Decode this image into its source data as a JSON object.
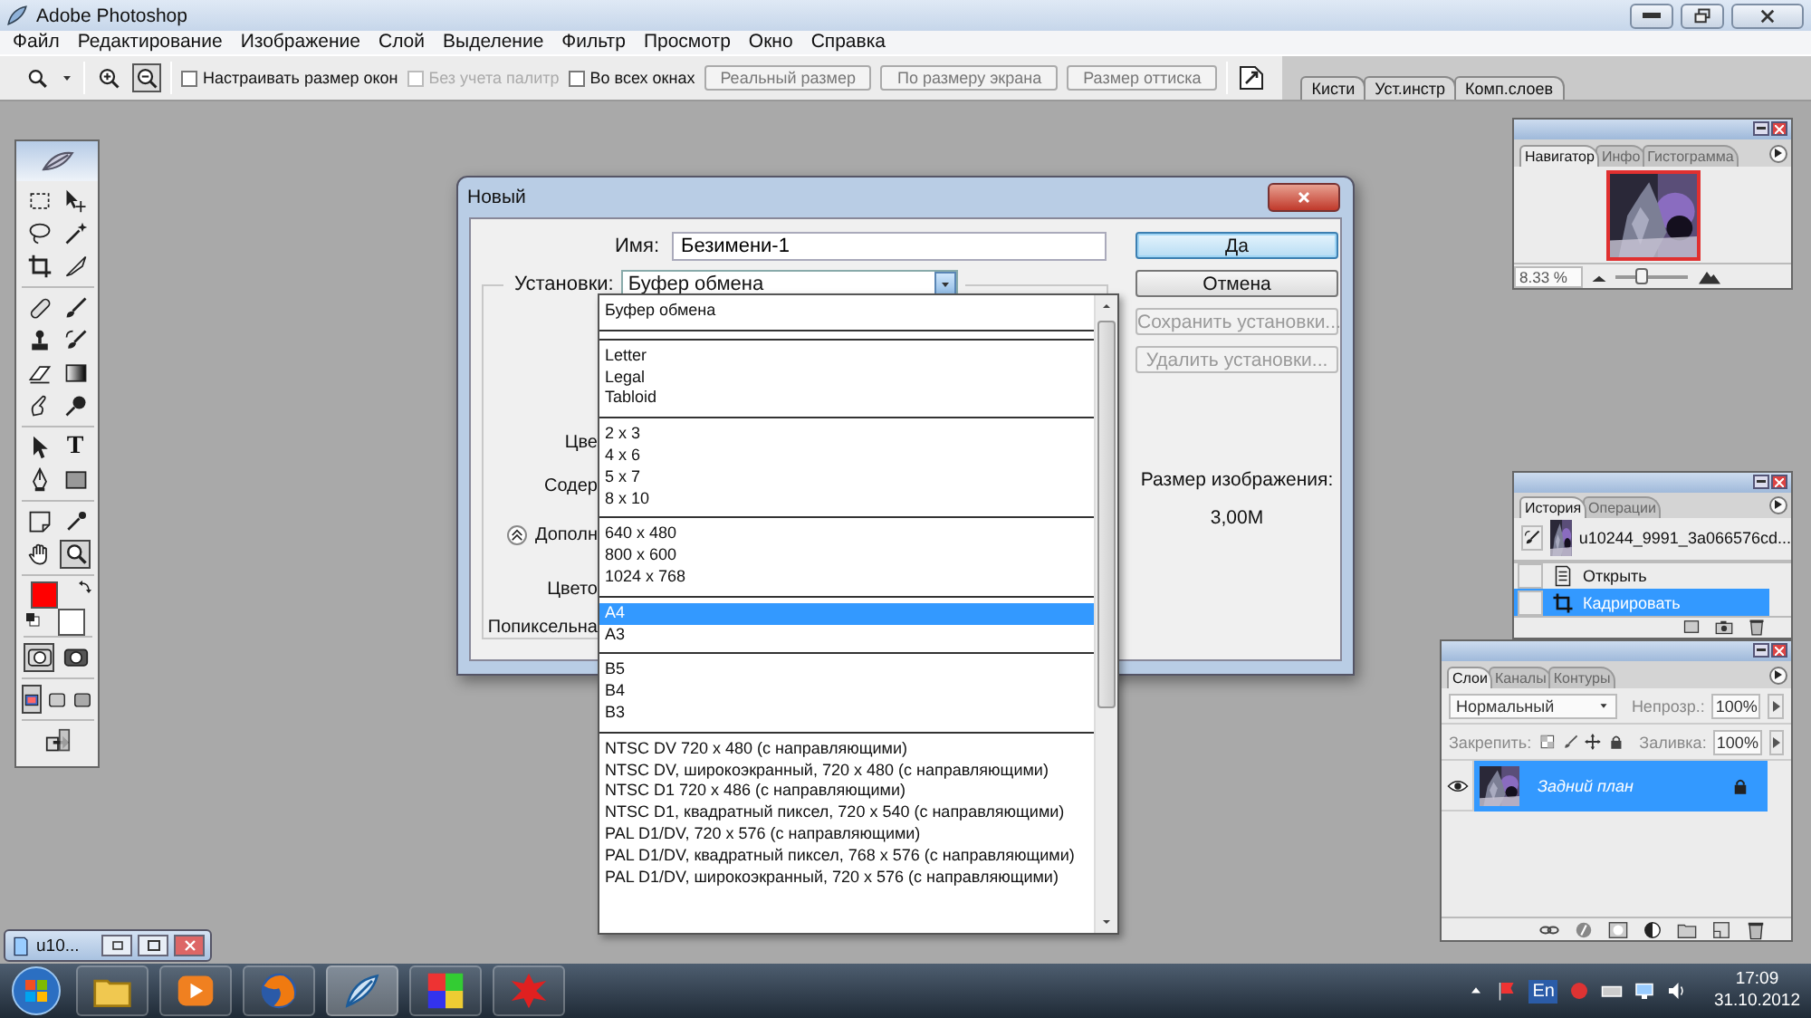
{
  "window": {
    "title": "Adobe Photoshop"
  },
  "menu": [
    "Файл",
    "Редактирование",
    "Изображение",
    "Слой",
    "Выделение",
    "Фильтр",
    "Просмотр",
    "Окно",
    "Справка"
  ],
  "options_bar": {
    "zoom_modes": [
      {
        "kind": "zoom-in",
        "selected": false
      },
      {
        "kind": "zoom-out",
        "selected": true
      }
    ],
    "checkboxes": [
      {
        "label": "Настраивать размер окон",
        "checked": false,
        "disabled": false
      },
      {
        "label": "Без учета палитр",
        "checked": false,
        "disabled": true
      },
      {
        "label": "Во всех окнах",
        "checked": false,
        "disabled": false
      }
    ],
    "buttons": [
      "Реальный размер",
      "По размеру экрана",
      "Размер оттиска"
    ],
    "palette_tabs": [
      {
        "label": "Кисти",
        "selected": false
      },
      {
        "label": "Уст.инстр",
        "selected": false
      },
      {
        "label": "Комп.слоев",
        "selected": false
      }
    ]
  },
  "toolbox": {
    "tool_groups": [
      [
        {
          "kind": "marquee",
          "selected": false
        },
        {
          "kind": "move",
          "selected": false
        },
        {
          "kind": "lasso",
          "selected": false
        },
        {
          "kind": "wand",
          "selected": false
        },
        {
          "kind": "crop",
          "selected": false
        },
        {
          "kind": "slice",
          "selected": false
        }
      ],
      [
        {
          "kind": "healing",
          "selected": false
        },
        {
          "kind": "brush",
          "selected": false
        },
        {
          "kind": "stamp",
          "selected": false
        },
        {
          "kind": "history-brush",
          "selected": false
        },
        {
          "kind": "eraser",
          "selected": false
        },
        {
          "kind": "gradient",
          "selected": false
        },
        {
          "kind": "smudge",
          "selected": false
        },
        {
          "kind": "dodge",
          "selected": false
        }
      ],
      [
        {
          "kind": "path-select",
          "selected": false
        },
        {
          "kind": "type",
          "label": "T",
          "selected": false
        },
        {
          "kind": "pen",
          "selected": false
        },
        {
          "kind": "shape",
          "selected": false
        }
      ],
      [
        {
          "kind": "notes",
          "selected": false
        },
        {
          "kind": "eyedropper",
          "selected": false
        },
        {
          "kind": "hand",
          "selected": false
        },
        {
          "kind": "zoom",
          "selected": true
        }
      ],
      [
        {
          "kind": "standard-mode",
          "selected": true
        },
        {
          "kind": "quick-mask",
          "selected": false
        }
      ],
      [
        {
          "kind": "screen-standard",
          "selected": true
        },
        {
          "kind": "screen-menu",
          "selected": false
        },
        {
          "kind": "screen-full",
          "selected": false
        }
      ],
      [
        {
          "kind": "jump",
          "selected": false
        }
      ]
    ],
    "swatches": [
      {
        "kind": "foreground",
        "color": "#ff0000"
      },
      {
        "kind": "background",
        "color": "#ffffff"
      }
    ]
  },
  "dialog": {
    "title": "Новый",
    "name_label": "Имя:",
    "name_value": "Безимени-1",
    "preset_label": "Установки:",
    "preset_value": "Буфер обмена",
    "hidden_labels": [
      {
        "kind": "label",
        "text": "Цве"
      },
      {
        "kind": "label",
        "text": "Содер"
      },
      {
        "kind": "expander",
        "text": "Дополн"
      },
      {
        "kind": "label",
        "text": "Цвето"
      },
      {
        "kind": "label",
        "text": "Попиксельна"
      }
    ],
    "buttons": [
      {
        "label": "Да",
        "kind": "default",
        "disabled": false
      },
      {
        "label": "Отмена",
        "kind": "normal",
        "disabled": false
      },
      {
        "label": "Сохранить установки...",
        "kind": "normal",
        "disabled": true
      },
      {
        "label": "Удалить установки...",
        "kind": "normal",
        "disabled": true
      }
    ],
    "image_size_label": "Размер изображения:",
    "image_size_value": "3,00M"
  },
  "preset_list": [
    {
      "kind": "option",
      "label": "Буфер обмена",
      "selected": false
    },
    {
      "kind": "separator"
    },
    {
      "kind": "separator"
    },
    {
      "kind": "option",
      "label": "Letter",
      "selected": false
    },
    {
      "kind": "option",
      "label": "Legal",
      "selected": false
    },
    {
      "kind": "option",
      "label": "Tabloid",
      "selected": false
    },
    {
      "kind": "separator"
    },
    {
      "kind": "option",
      "label": "2 x 3",
      "selected": false
    },
    {
      "kind": "option",
      "label": "4 x 6",
      "selected": false
    },
    {
      "kind": "option",
      "label": "5 x 7",
      "selected": false
    },
    {
      "kind": "option",
      "label": "8 x 10",
      "selected": false
    },
    {
      "kind": "separator"
    },
    {
      "kind": "option",
      "label": "640 x 480",
      "selected": false
    },
    {
      "kind": "option",
      "label": "800 x 600",
      "selected": false
    },
    {
      "kind": "option",
      "label": "1024 x 768",
      "selected": false
    },
    {
      "kind": "separator"
    },
    {
      "kind": "option",
      "label": "A4",
      "selected": true
    },
    {
      "kind": "option",
      "label": "A3",
      "selected": false
    },
    {
      "kind": "separator"
    },
    {
      "kind": "option",
      "label": "B5",
      "selected": false
    },
    {
      "kind": "option",
      "label": "B4",
      "selected": false
    },
    {
      "kind": "option",
      "label": "B3",
      "selected": false
    },
    {
      "kind": "separator"
    },
    {
      "kind": "option",
      "label": "NTSC DV 720 x 480 (с направляющими)",
      "selected": false
    },
    {
      "kind": "option",
      "label": "NTSC DV, широкоэкранный, 720 x 480 (с направляющими)",
      "selected": false
    },
    {
      "kind": "option",
      "label": "NTSC D1 720 x 486 (с направляющими)",
      "selected": false
    },
    {
      "kind": "option",
      "label": "NTSC D1, квадратный пиксел, 720 x 540 (с направляющими)",
      "selected": false
    },
    {
      "kind": "option",
      "label": "PAL D1/DV, 720 x 576 (с направляющими)",
      "selected": false
    },
    {
      "kind": "option",
      "label": "PAL D1/DV, квадратный пиксел, 768 x 576 (с направляющими)",
      "selected": false
    },
    {
      "kind": "option",
      "label": "PAL D1/DV, широкоэкранный, 720 x 576 (с направляющими)",
      "selected": false
    }
  ],
  "navigator": {
    "tabs": [
      {
        "label": "Навигатор",
        "selected": true
      },
      {
        "label": "Инфо",
        "selected": false
      },
      {
        "label": "Гистограмма",
        "selected": false
      }
    ],
    "zoom": "8.33 %",
    "level": 0.35
  },
  "history": {
    "tabs": [
      {
        "label": "История",
        "selected": true
      },
      {
        "label": "Операции",
        "selected": false
      }
    ],
    "snapshot": "u10244_9991_3a066576cd...",
    "steps": [
      {
        "kind": "open",
        "label": "Открыть",
        "selected": false
      },
      {
        "kind": "crop",
        "label": "Кадрировать",
        "selected": true
      }
    ]
  },
  "layers": {
    "tabs": [
      {
        "label": "Слои",
        "selected": true
      },
      {
        "label": "Каналы",
        "selected": false
      },
      {
        "label": "Контуры",
        "selected": false
      }
    ],
    "blend_mode": "Нормальный",
    "opacity_label": "Непрозр.:",
    "opacity": "100%",
    "lock_label": "Закрепить:",
    "fill_label": "Заливка:",
    "fill": "100%",
    "items": [
      {
        "name": "Задний план",
        "visible": true,
        "selected": true,
        "locked": true
      }
    ]
  },
  "minimized_doc": {
    "title": "u10..."
  },
  "taskbar": {
    "language": "En",
    "time": "17:09",
    "date": "31.10.2012"
  }
}
